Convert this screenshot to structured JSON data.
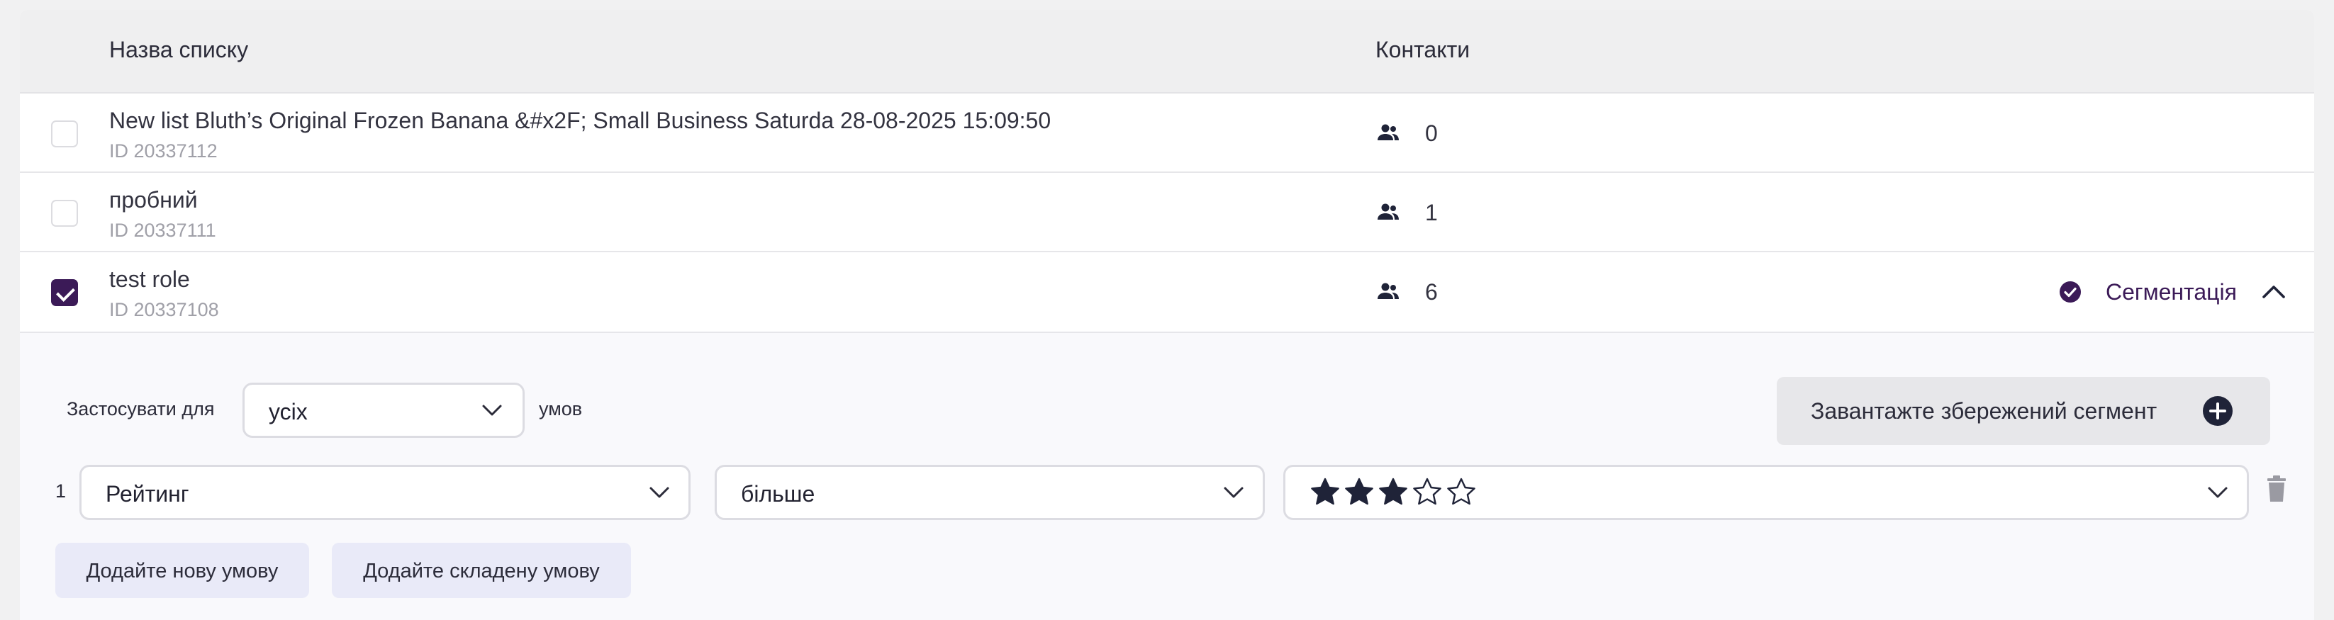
{
  "table": {
    "headers": {
      "name": "Назва списку",
      "contacts": "Контакти"
    },
    "rows": [
      {
        "title": "New list Bluth’s Original Frozen Banana &#x2F; Small Business Saturda 28-08-2025 15:09:50",
        "id": "ID 20337112",
        "contacts": "0",
        "checked": false
      },
      {
        "title": "пробний",
        "id": "ID 20337111",
        "contacts": "1",
        "checked": false
      },
      {
        "title": "test role",
        "id": "ID 20337108",
        "contacts": "6",
        "checked": true,
        "segmentation_label": "Сегментація"
      }
    ]
  },
  "segment": {
    "apply_label": "Застосувати для",
    "apply_value": "усіх",
    "units_label": "умов",
    "load_button": "Завантажте збережений сегмент",
    "conditions": [
      {
        "number": "1",
        "field": "Рейтинг",
        "operator": "більше",
        "rating": 3,
        "rating_max": 5
      }
    ],
    "add_condition": "Додайте нову умову",
    "add_complex": "Додайте складену умову"
  },
  "colors": {
    "accent": "#3b1a57",
    "header_bg": "#efeff0",
    "button_bg": "#e9eaf8",
    "star": "#1f2338"
  }
}
